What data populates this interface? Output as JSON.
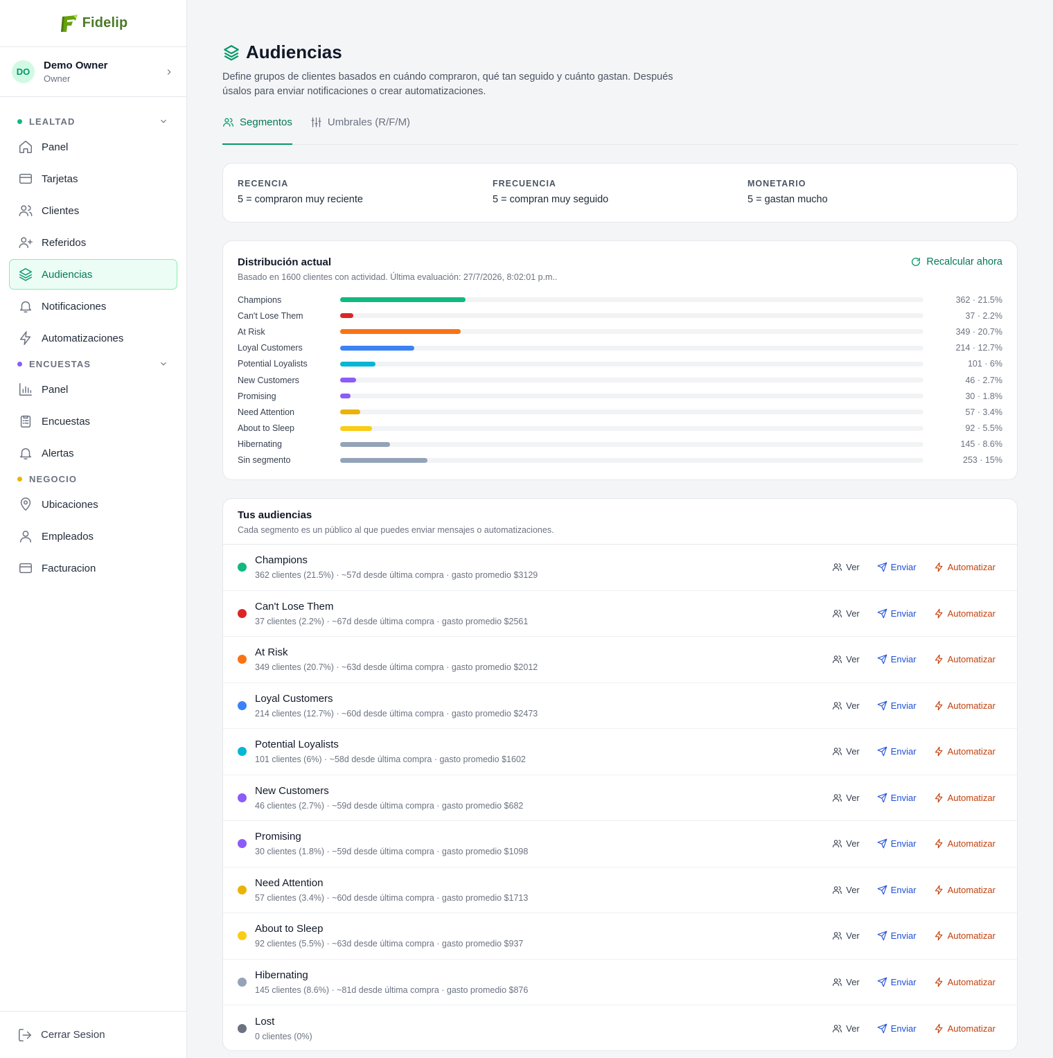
{
  "brand": {
    "name": "Fidelip"
  },
  "user": {
    "initials": "DO",
    "name": "Demo Owner",
    "role": "Owner"
  },
  "sidebar": {
    "sections": [
      {
        "label": "LEALTAD",
        "dot_color": "#10b981",
        "collapsible": true,
        "items": [
          {
            "label": "Panel",
            "icon": "home-icon"
          },
          {
            "label": "Tarjetas",
            "icon": "card-icon"
          },
          {
            "label": "Clientes",
            "icon": "users-icon"
          },
          {
            "label": "Referidos",
            "icon": "user-plus-icon"
          },
          {
            "label": "Audiencias",
            "icon": "layers-icon",
            "active": true
          },
          {
            "label": "Notificaciones",
            "icon": "bell-icon"
          },
          {
            "label": "Automatizaciones",
            "icon": "bolt-icon"
          }
        ]
      },
      {
        "label": "ENCUESTAS",
        "dot_color": "#8b5cf6",
        "collapsible": true,
        "items": [
          {
            "label": "Panel",
            "icon": "bar-chart-icon"
          },
          {
            "label": "Encuestas",
            "icon": "clipboard-icon"
          },
          {
            "label": "Alertas",
            "icon": "bell-icon"
          }
        ]
      },
      {
        "label": "NEGOCIO",
        "dot_color": "#eab308",
        "collapsible": false,
        "items": [
          {
            "label": "Ubicaciones",
            "icon": "map-pin-icon"
          },
          {
            "label": "Empleados",
            "icon": "user-icon"
          },
          {
            "label": "Facturacion",
            "icon": "card-icon"
          }
        ]
      }
    ],
    "logout": "Cerrar Sesion"
  },
  "page": {
    "title": "Audiencias",
    "subtitle": "Define grupos de clientes basados en cuándo compraron, qué tan seguido y cuánto gastan. Después úsalos para enviar notificaciones o crear automatizaciones.",
    "tabs": [
      {
        "label": "Segmentos",
        "icon": "users-icon",
        "active": true
      },
      {
        "label": "Umbrales (R/F/M)",
        "icon": "sliders-icon",
        "active": false
      }
    ]
  },
  "rfm": [
    {
      "label": "RECENCIA",
      "value": "5 = compraron muy reciente"
    },
    {
      "label": "FRECUENCIA",
      "value": "5 = compran muy seguido"
    },
    {
      "label": "MONETARIO",
      "value": "5 = gastan mucho"
    }
  ],
  "distribution": {
    "title": "Distribución actual",
    "subtitle": "Basado en 1600 clientes con actividad. Última evaluación: 27/7/2026, 8:02:01 p.m..",
    "recalc_label": "Recalcular ahora",
    "rows": [
      {
        "label": "Champions",
        "count": 362,
        "value_text": "362 · 21.5%",
        "percent": 21.5,
        "color": "#10b981"
      },
      {
        "label": "Can't Lose Them",
        "count": 37,
        "value_text": "37 · 2.2%",
        "percent": 2.2,
        "color": "#dc2626"
      },
      {
        "label": "At Risk",
        "count": 349,
        "value_text": "349 · 20.7%",
        "percent": 20.7,
        "color": "#f97316"
      },
      {
        "label": "Loyal Customers",
        "count": 214,
        "value_text": "214 · 12.7%",
        "percent": 12.7,
        "color": "#3b82f6"
      },
      {
        "label": "Potential Loyalists",
        "count": 101,
        "value_text": "101 · 6%",
        "percent": 6,
        "color": "#06b6d4"
      },
      {
        "label": "New Customers",
        "count": 46,
        "value_text": "46 · 2.7%",
        "percent": 2.7,
        "color": "#8b5cf6"
      },
      {
        "label": "Promising",
        "count": 30,
        "value_text": "30 · 1.8%",
        "percent": 1.8,
        "color": "#8b5cf6"
      },
      {
        "label": "Need Attention",
        "count": 57,
        "value_text": "57 · 3.4%",
        "percent": 3.4,
        "color": "#eab308"
      },
      {
        "label": "About to Sleep",
        "count": 92,
        "value_text": "92 · 5.5%",
        "percent": 5.5,
        "color": "#facc15"
      },
      {
        "label": "Hibernating",
        "count": 145,
        "value_text": "145 · 8.6%",
        "percent": 8.6,
        "color": "#94a3b8"
      },
      {
        "label": "Sin segmento",
        "count": 253,
        "value_text": "253 · 15%",
        "percent": 15,
        "color": "#94a3b8"
      }
    ]
  },
  "audiences": {
    "title": "Tus audiencias",
    "subtitle": "Cada segmento es un público al que puedes enviar mensajes o automatizaciones.",
    "actions": {
      "view": "Ver",
      "send": "Enviar",
      "automate": "Automatizar"
    },
    "rows": [
      {
        "name": "Champions",
        "meta": "362 clientes (21.5%) · ~57d desde última compra · gasto promedio $3129",
        "color": "#10b981"
      },
      {
        "name": "Can't Lose Them",
        "meta": "37 clientes (2.2%) · ~67d desde última compra · gasto promedio $2561",
        "color": "#dc2626"
      },
      {
        "name": "At Risk",
        "meta": "349 clientes (20.7%) · ~63d desde última compra · gasto promedio $2012",
        "color": "#f97316"
      },
      {
        "name": "Loyal Customers",
        "meta": "214 clientes (12.7%) · ~60d desde última compra · gasto promedio $2473",
        "color": "#3b82f6"
      },
      {
        "name": "Potential Loyalists",
        "meta": "101 clientes (6%) · ~58d desde última compra · gasto promedio $1602",
        "color": "#06b6d4"
      },
      {
        "name": "New Customers",
        "meta": "46 clientes (2.7%) · ~59d desde última compra · gasto promedio $682",
        "color": "#8b5cf6"
      },
      {
        "name": "Promising",
        "meta": "30 clientes (1.8%) · ~59d desde última compra · gasto promedio $1098",
        "color": "#8b5cf6"
      },
      {
        "name": "Need Attention",
        "meta": "57 clientes (3.4%) · ~60d desde última compra · gasto promedio $1713",
        "color": "#eab308"
      },
      {
        "name": "About to Sleep",
        "meta": "92 clientes (5.5%) · ~63d desde última compra · gasto promedio $937",
        "color": "#facc15"
      },
      {
        "name": "Hibernating",
        "meta": "145 clientes (8.6%) · ~81d desde última compra · gasto promedio $876",
        "color": "#94a3b8"
      },
      {
        "name": "Lost",
        "meta": "0 clientes (0%)",
        "color": "#6b7280"
      }
    ]
  },
  "colors": {
    "accent": "#059669",
    "send": "#1d4ed8",
    "automate": "#c2410c"
  }
}
